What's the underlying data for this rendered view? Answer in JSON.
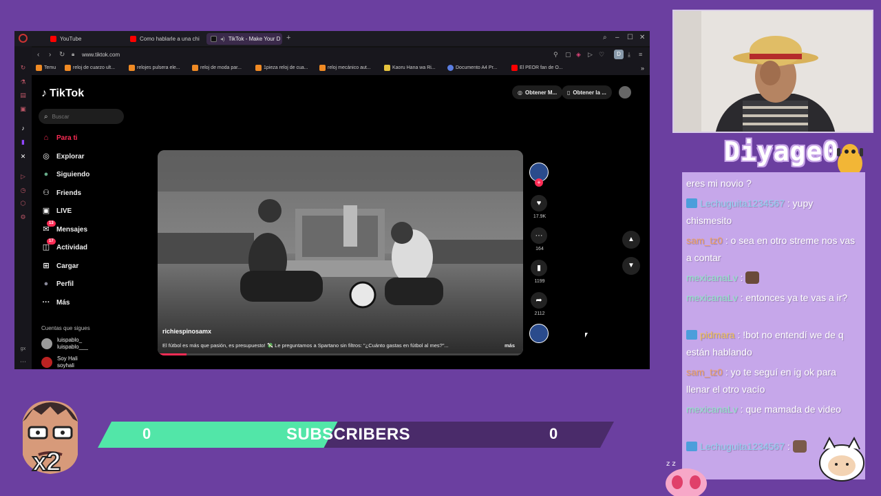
{
  "browser": {
    "tabs": [
      {
        "label": "YouTube",
        "color": "#ff0000"
      },
      {
        "label": "Como hablarle a una chi",
        "color": "#ff0000"
      },
      {
        "label": "TikTok - Make Your D",
        "color": "#222222",
        "active": true
      }
    ],
    "tab_add": "+",
    "window_controls": [
      "⌕",
      "–",
      "☐",
      "✕"
    ],
    "url": "www.tiktok.com",
    "profile_letter": "D",
    "bookmarks": [
      {
        "label": "Temu"
      },
      {
        "label": "reloj de cuarzo ult..."
      },
      {
        "label": "relojes pulsera ele..."
      },
      {
        "label": "reloj de moda par..."
      },
      {
        "label": "1pieza reloj de cua..."
      },
      {
        "label": "reloj mecánico aut..."
      },
      {
        "label": "Kaoru Hana wa Ri..."
      },
      {
        "label": "Documento A4 Pr..."
      },
      {
        "label": "El PEOR fan de O..."
      }
    ],
    "bookmarks_more": "»"
  },
  "tiktok": {
    "logo": "TikTok",
    "search_placeholder": "Buscar",
    "nav": [
      {
        "label": "Para ti",
        "icon": "home-icon",
        "glyph": "⌂",
        "active": true
      },
      {
        "label": "Explorar",
        "icon": "compass-icon",
        "glyph": "◎"
      },
      {
        "label": "Siguiendo",
        "icon": "following-icon",
        "glyph": "●"
      },
      {
        "label": "Friends",
        "icon": "friends-icon",
        "glyph": "⚇"
      },
      {
        "label": "LIVE",
        "icon": "live-icon",
        "glyph": "▣"
      },
      {
        "label": "Mensajes",
        "icon": "messages-icon",
        "glyph": "✉",
        "badge": "13"
      },
      {
        "label": "Actividad",
        "icon": "activity-icon",
        "glyph": "◫",
        "badge": "17"
      },
      {
        "label": "Cargar",
        "icon": "upload-icon",
        "glyph": "⊞"
      },
      {
        "label": "Perfil",
        "icon": "profile-icon",
        "glyph": "●"
      },
      {
        "label": "Más",
        "icon": "more-icon",
        "glyph": "···"
      }
    ],
    "following_title": "Cuentas que sigues",
    "following": [
      {
        "name": "luispablo_",
        "handle": "luispablo___"
      },
      {
        "name": "Soy Hali",
        "handle": "soyhali"
      }
    ],
    "top_buttons": [
      {
        "label": "Obtener M...",
        "icon": "coin-icon",
        "glyph": "◎"
      },
      {
        "label": "Obtener la ...",
        "icon": "phone-icon",
        "glyph": "▯"
      }
    ],
    "video": {
      "username": "richiespinosamx",
      "description": "El fútbol es más que pasión, es presupuesto! 💸 Le preguntamos a Spartano sin filtros: \"¿Cuánto gastas en fútbol al mes?\"...",
      "more": "más",
      "progress": 0.08
    },
    "actions": {
      "likes": "17.9K",
      "comments": "164",
      "saves": "1199",
      "shares": "2112"
    }
  },
  "chat": {
    "logo": "Diyage0",
    "messages": [
      {
        "user": "",
        "text": "eres mi novio ?",
        "user_color": "#ffffff"
      },
      {
        "user": "Lechuguita1234567",
        "text": ": yupy chismesito",
        "user_color": "#8fd3f0",
        "platform": true
      },
      {
        "user": "sam_tz0",
        "text": ": o sea en otro streme nos vas a contar",
        "user_color": "#f0a060"
      },
      {
        "user": "mexicanaLv",
        "text": ": ",
        "user_color": "#8fe8c8",
        "emote": true
      },
      {
        "user": "mexicanaLv",
        "text": ": entonces ya te vas a ir?",
        "user_color": "#8fe8c8"
      },
      {
        "user": "pidmara",
        "text": ": !bot no entendí we de q están hablando",
        "user_color": "#f0c050",
        "platform": true
      },
      {
        "user": "sam_tz0",
        "text": ": yo te seguí en ig ok para llenar el otro vacío",
        "user_color": "#f0a060"
      },
      {
        "user": "mexicanaLv",
        "text": ": que mamada de video",
        "user_color": "#8fe8c8"
      },
      {
        "user": "Lechuguita1234567",
        "text": ": ",
        "user_color": "#8fd3f0",
        "platform": true,
        "emote": true
      }
    ]
  },
  "overlay": {
    "multiplier": "x2",
    "subscribers_label": "SUBSCRIBERS",
    "subs_current": "0",
    "subs_goal": "0",
    "subs_progress": 0.45
  }
}
